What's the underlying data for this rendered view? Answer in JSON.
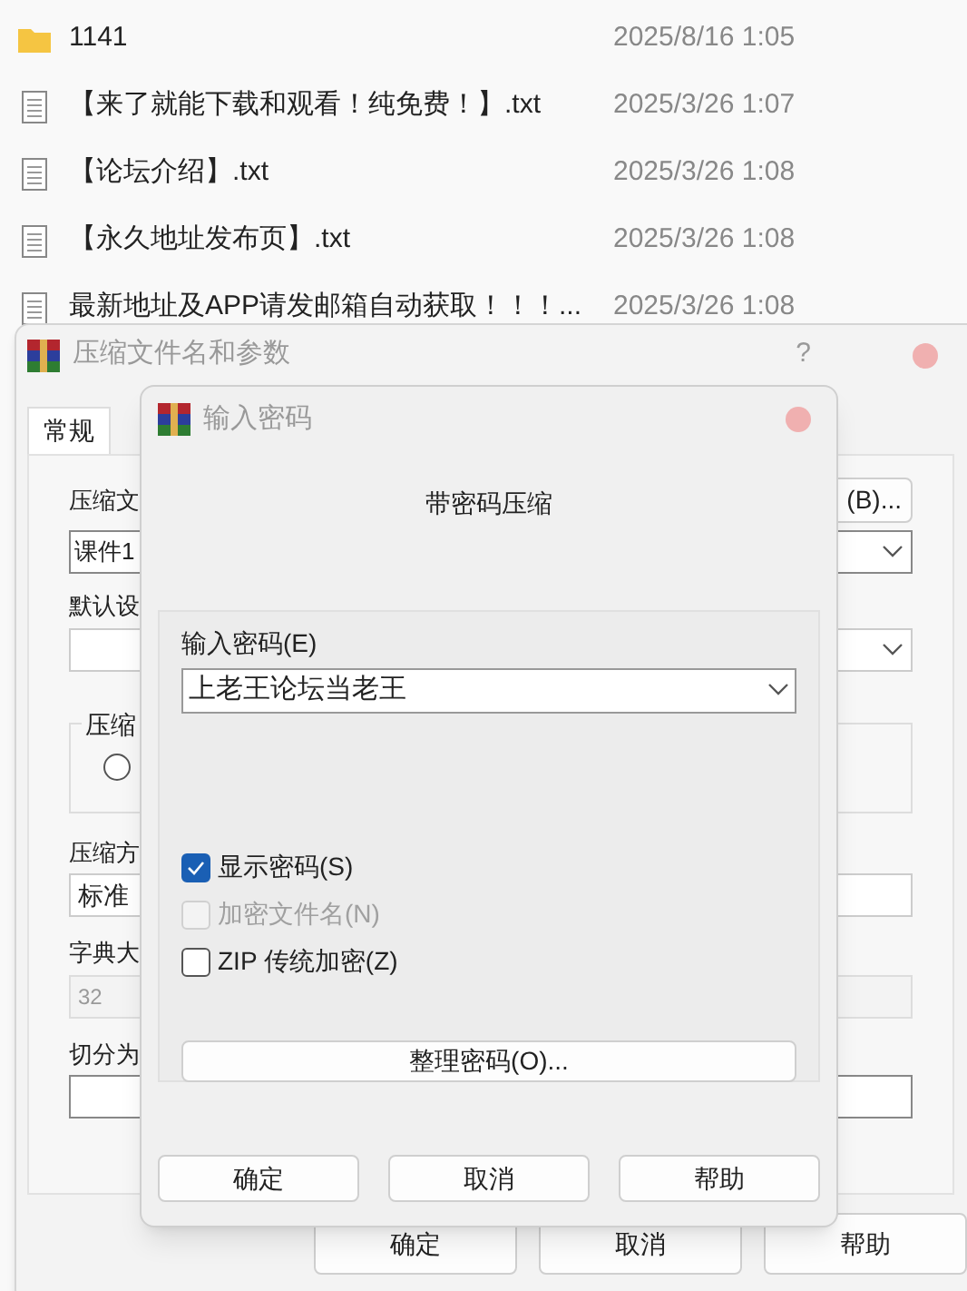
{
  "file_list": {
    "rows": [
      {
        "kind": "folder",
        "name": "1141",
        "date": "2025/8/16 1:05"
      },
      {
        "kind": "file",
        "name": "【来了就能下载和观看！纯免费！】.txt",
        "date": "2025/3/26 1:07"
      },
      {
        "kind": "file",
        "name": "【论坛介绍】.txt",
        "date": "2025/3/26 1:08"
      },
      {
        "kind": "file",
        "name": "【永久地址发布页】.txt",
        "date": "2025/3/26 1:08"
      },
      {
        "kind": "file",
        "name": "最新地址及APP请发邮箱自动获取！！！...",
        "date": "2025/3/26 1:08"
      }
    ]
  },
  "archive_dialog": {
    "title": "压缩文件名和参数",
    "help": "?",
    "tabs": [
      {
        "label": "常规",
        "selected": true
      }
    ],
    "archive_name_label": "压缩文",
    "browse_button": "(B)...",
    "archive_name_value": "课件1",
    "profile_label": "默认设",
    "group_label": "压缩",
    "radio": {
      "selected": false
    },
    "method_label": "压缩方",
    "method_value": "标准",
    "dictionary_label": "字典大",
    "dictionary_value": "32",
    "split_label": "切分为",
    "buttons": [
      "确定",
      "取消",
      "帮助"
    ]
  },
  "password_dialog": {
    "title": "输入密码",
    "heading": "带密码压缩",
    "password_label": "输入密码(E)",
    "password_value": "上老王论坛当老王",
    "options": [
      {
        "label": "显示密码(S)",
        "checked": true,
        "disabled": false
      },
      {
        "label": "加密文件名(N)",
        "checked": false,
        "disabled": true
      },
      {
        "label": "ZIP 传统加密(Z)",
        "checked": false,
        "disabled": false
      }
    ],
    "organize_button": "整理密码(O)...",
    "buttons": [
      "确定",
      "取消",
      "帮助"
    ]
  }
}
